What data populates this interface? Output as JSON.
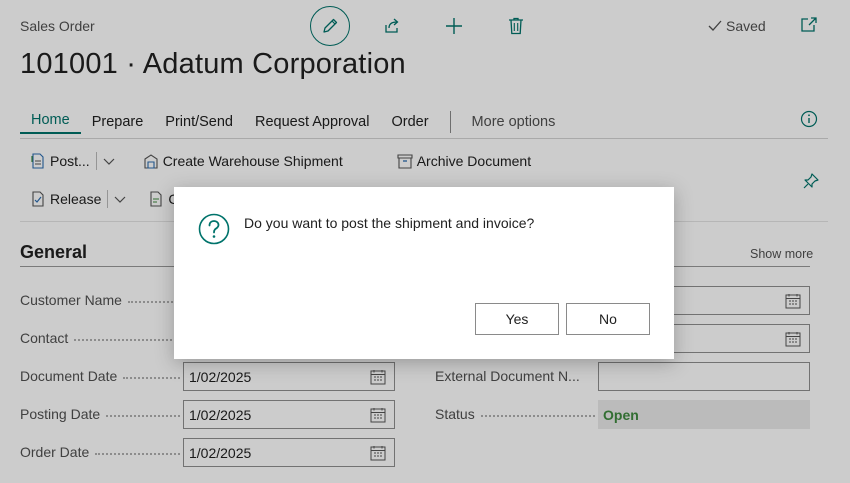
{
  "header": {
    "entity_type": "Sales Order",
    "title": "101001 · Adatum Corporation",
    "saved_label": "Saved"
  },
  "tabs": [
    {
      "label": "Home",
      "active": true
    },
    {
      "label": "Prepare"
    },
    {
      "label": "Print/Send"
    },
    {
      "label": "Request Approval"
    },
    {
      "label": "Order"
    },
    {
      "label": "More options"
    }
  ],
  "actions": {
    "post": "Post...",
    "create_warehouse_shipment": "Create Warehouse Shipment",
    "archive_document": "Archive Document",
    "release": "Release",
    "second_row_partial": "C"
  },
  "section": {
    "title": "General",
    "show_more": "Show more"
  },
  "fields": {
    "customer_name": {
      "label": "Customer Name"
    },
    "contact": {
      "label": "Contact"
    },
    "document_date": {
      "label": "Document Date",
      "value": "1/02/2025"
    },
    "posting_date": {
      "label": "Posting Date",
      "value": "1/02/2025"
    },
    "order_date": {
      "label": "Order Date",
      "value": "1/02/2025"
    },
    "external_document_no": {
      "label": "External Document N...",
      "value": ""
    },
    "status": {
      "label": "Status",
      "value": "Open"
    }
  },
  "dialog": {
    "message": "Do you want to post the shipment and invoice?",
    "yes_label": "Yes",
    "no_label": "No"
  },
  "colors": {
    "accent": "#00736b",
    "status_open": "#3f8a3f"
  }
}
